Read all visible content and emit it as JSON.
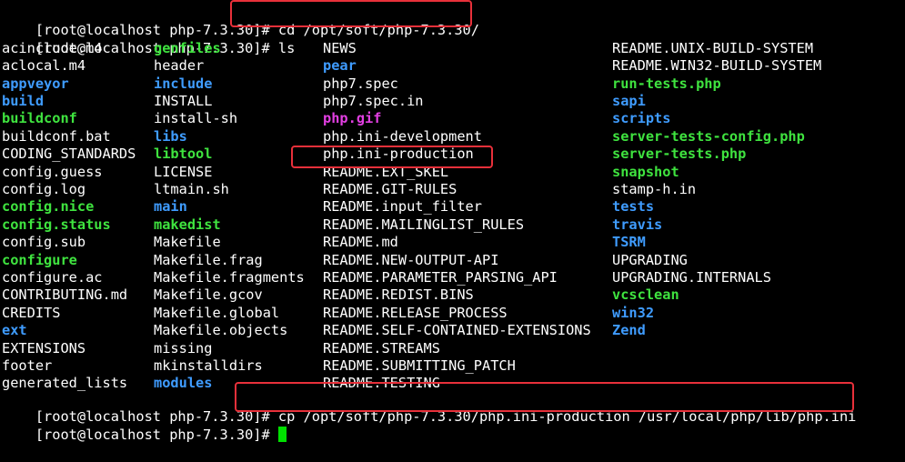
{
  "terminal": {
    "prompt": "[root@localhost php-7.3.30]# ",
    "commands": [
      "cd /opt/soft/php-7.3.30/",
      "ls",
      "cp /opt/soft/php-7.3.30/php.ini-production /usr/local/php/lib/php.ini",
      ""
    ],
    "colors": {
      "background": "#000000",
      "plain": "#ffffff",
      "directory": "#3f9cff",
      "executable": "#3fe33f",
      "image": "#e23fe2",
      "cursor": "#00e000",
      "highlight": "#e8303a"
    },
    "listing_columns": [
      [
        {
          "name": "acinclude.m4",
          "type": "plain"
        },
        {
          "name": "aclocal.m4",
          "type": "plain"
        },
        {
          "name": "appveyor",
          "type": "dir"
        },
        {
          "name": "build",
          "type": "dir"
        },
        {
          "name": "buildconf",
          "type": "exec"
        },
        {
          "name": "buildconf.bat",
          "type": "plain"
        },
        {
          "name": "CODING_STANDARDS",
          "type": "plain"
        },
        {
          "name": "config.guess",
          "type": "plain"
        },
        {
          "name": "config.log",
          "type": "plain"
        },
        {
          "name": "config.nice",
          "type": "exec"
        },
        {
          "name": "config.status",
          "type": "exec"
        },
        {
          "name": "config.sub",
          "type": "plain"
        },
        {
          "name": "configure",
          "type": "exec"
        },
        {
          "name": "configure.ac",
          "type": "plain"
        },
        {
          "name": "CONTRIBUTING.md",
          "type": "plain"
        },
        {
          "name": "CREDITS",
          "type": "plain"
        },
        {
          "name": "ext",
          "type": "dir"
        },
        {
          "name": "EXTENSIONS",
          "type": "plain"
        },
        {
          "name": "footer",
          "type": "plain"
        },
        {
          "name": "generated_lists",
          "type": "plain"
        }
      ],
      [
        {
          "name": "genfiles",
          "type": "exec"
        },
        {
          "name": "header",
          "type": "plain"
        },
        {
          "name": "include",
          "type": "dir"
        },
        {
          "name": "INSTALL",
          "type": "plain"
        },
        {
          "name": "install-sh",
          "type": "plain"
        },
        {
          "name": "libs",
          "type": "dir"
        },
        {
          "name": "libtool",
          "type": "exec"
        },
        {
          "name": "LICENSE",
          "type": "plain"
        },
        {
          "name": "ltmain.sh",
          "type": "plain"
        },
        {
          "name": "main",
          "type": "dir"
        },
        {
          "name": "makedist",
          "type": "exec"
        },
        {
          "name": "Makefile",
          "type": "plain"
        },
        {
          "name": "Makefile.frag",
          "type": "plain"
        },
        {
          "name": "Makefile.fragments",
          "type": "plain"
        },
        {
          "name": "Makefile.gcov",
          "type": "plain"
        },
        {
          "name": "Makefile.global",
          "type": "plain"
        },
        {
          "name": "Makefile.objects",
          "type": "plain"
        },
        {
          "name": "missing",
          "type": "plain"
        },
        {
          "name": "mkinstalldirs",
          "type": "plain"
        },
        {
          "name": "modules",
          "type": "dir"
        }
      ],
      [
        {
          "name": "NEWS",
          "type": "plain"
        },
        {
          "name": "pear",
          "type": "dir"
        },
        {
          "name": "php7.spec",
          "type": "plain"
        },
        {
          "name": "php7.spec.in",
          "type": "plain"
        },
        {
          "name": "php.gif",
          "type": "image"
        },
        {
          "name": "php.ini-development",
          "type": "plain"
        },
        {
          "name": "php.ini-production",
          "type": "plain"
        },
        {
          "name": "README.EXT_SKEL",
          "type": "plain"
        },
        {
          "name": "README.GIT-RULES",
          "type": "plain"
        },
        {
          "name": "README.input_filter",
          "type": "plain"
        },
        {
          "name": "README.MAILINGLIST_RULES",
          "type": "plain"
        },
        {
          "name": "README.md",
          "type": "plain"
        },
        {
          "name": "README.NEW-OUTPUT-API",
          "type": "plain"
        },
        {
          "name": "README.PARAMETER_PARSING_API",
          "type": "plain"
        },
        {
          "name": "README.REDIST.BINS",
          "type": "plain"
        },
        {
          "name": "README.RELEASE_PROCESS",
          "type": "plain"
        },
        {
          "name": "README.SELF-CONTAINED-EXTENSIONS",
          "type": "plain"
        },
        {
          "name": "README.STREAMS",
          "type": "plain"
        },
        {
          "name": "README.SUBMITTING_PATCH",
          "type": "plain"
        },
        {
          "name": "README.TESTING",
          "type": "plain"
        }
      ],
      [
        {
          "name": "README.UNIX-BUILD-SYSTEM",
          "type": "plain"
        },
        {
          "name": "README.WIN32-BUILD-SYSTEM",
          "type": "plain"
        },
        {
          "name": "run-tests.php",
          "type": "exec"
        },
        {
          "name": "sapi",
          "type": "dir"
        },
        {
          "name": "scripts",
          "type": "dir"
        },
        {
          "name": "server-tests-config.php",
          "type": "exec"
        },
        {
          "name": "server-tests.php",
          "type": "exec"
        },
        {
          "name": "snapshot",
          "type": "exec"
        },
        {
          "name": "stamp-h.in",
          "type": "plain"
        },
        {
          "name": "tests",
          "type": "dir"
        },
        {
          "name": "travis",
          "type": "dir"
        },
        {
          "name": "TSRM",
          "type": "dir"
        },
        {
          "name": "UPGRADING",
          "type": "plain"
        },
        {
          "name": "UPGRADING.INTERNALS",
          "type": "plain"
        },
        {
          "name": "vcsclean",
          "type": "exec"
        },
        {
          "name": "win32",
          "type": "dir"
        },
        {
          "name": "Zend",
          "type": "dir"
        }
      ]
    ]
  }
}
